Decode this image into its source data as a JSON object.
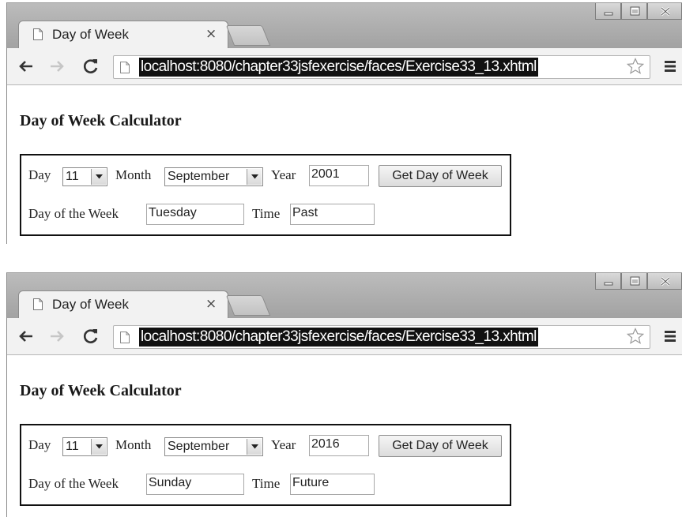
{
  "windows": [
    {
      "tab_title": "Day of Week",
      "tab_close": "×",
      "url": "localhost:8080/chapter33jsfexercise/faces/Exercise33_13.xhtml",
      "heading": "Day of Week Calculator",
      "form": {
        "day_label": "Day",
        "day_value": "11",
        "month_label": "Month",
        "month_value": "September",
        "year_label": "Year",
        "year_value": "2001",
        "button_label": "Get Day of Week",
        "dow_label": "Day of the Week",
        "dow_value": "Tuesday",
        "time_label": "Time",
        "time_value": "Past"
      }
    },
    {
      "tab_title": "Day of Week",
      "tab_close": "×",
      "url": "localhost:8080/chapter33jsfexercise/faces/Exercise33_13.xhtml",
      "heading": "Day of Week Calculator",
      "form": {
        "day_label": "Day",
        "day_value": "11",
        "month_label": "Month",
        "month_value": "September",
        "year_label": "Year",
        "year_value": "2016",
        "button_label": "Get Day of Week",
        "dow_label": "Day of the Week",
        "dow_value": "Sunday",
        "time_label": "Time",
        "time_value": "Future"
      }
    }
  ],
  "colors": {
    "url_highlight": "#111111",
    "form_border": "#111111",
    "titlebar": "#a9a9a9"
  },
  "icons": [
    "page-icon",
    "back-arrow-icon",
    "forward-arrow-icon",
    "reload-icon",
    "star-icon",
    "hamburger-menu-icon",
    "minimize-icon",
    "maximize-icon",
    "close-icon"
  ]
}
